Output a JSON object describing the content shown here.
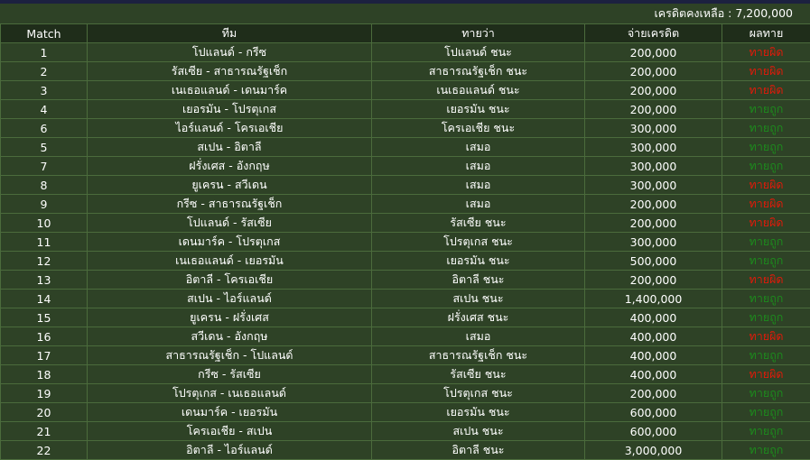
{
  "credit": {
    "text": "เครดิตคงเหลือ : 7,200,000"
  },
  "columns": [
    "Match",
    "ทีม",
    "ทายว่า",
    "จ่ายเครดิต",
    "ผลทาย"
  ],
  "colors": {
    "lose": "#e01a0a",
    "win": "#1d8a1d"
  },
  "rows": [
    {
      "match": "1",
      "team": "โปแลนด์ - กรีซ",
      "pick": "โปแลนด์ ชนะ",
      "pay": "200,000",
      "result": "ทายผิด",
      "result_type": "lose"
    },
    {
      "match": "2",
      "team": "รัสเซีย - สาธารณรัฐเช็ก",
      "pick": "สาธารณรัฐเช็ก ชนะ",
      "pay": "200,000",
      "result": "ทายผิด",
      "result_type": "lose"
    },
    {
      "match": "3",
      "team": "เนเธอแลนด์ - เดนมาร์ค",
      "pick": "เนเธอแลนด์ ชนะ",
      "pay": "200,000",
      "result": "ทายผิด",
      "result_type": "lose"
    },
    {
      "match": "4",
      "team": "เยอรมัน - โปรตุเกส",
      "pick": "เยอรมัน ชนะ",
      "pay": "200,000",
      "result": "ทายถูก",
      "result_type": "win"
    },
    {
      "match": "6",
      "team": "ไอร์แลนด์ - โครเอเชีย",
      "pick": "โครเอเชีย ชนะ",
      "pay": "300,000",
      "result": "ทายถูก",
      "result_type": "win"
    },
    {
      "match": "5",
      "team": "สเปน - อิตาลี",
      "pick": "เสมอ",
      "pay": "300,000",
      "result": "ทายถูก",
      "result_type": "win"
    },
    {
      "match": "7",
      "team": "ฝรั่งเศส - อังกฤษ",
      "pick": "เสมอ",
      "pay": "300,000",
      "result": "ทายถูก",
      "result_type": "win"
    },
    {
      "match": "8",
      "team": "ยูเครน - สวีเดน",
      "pick": "เสมอ",
      "pay": "300,000",
      "result": "ทายผิด",
      "result_type": "lose"
    },
    {
      "match": "9",
      "team": "กรีซ - สาธารณรัฐเช็ก",
      "pick": "เสมอ",
      "pay": "200,000",
      "result": "ทายผิด",
      "result_type": "lose"
    },
    {
      "match": "10",
      "team": "โปแลนด์ - รัสเซีย",
      "pick": "รัสเซีย ชนะ",
      "pay": "200,000",
      "result": "ทายผิด",
      "result_type": "lose"
    },
    {
      "match": "11",
      "team": "เดนมาร์ค - โปรตุเกส",
      "pick": "โปรตุเกส ชนะ",
      "pay": "300,000",
      "result": "ทายถูก",
      "result_type": "win"
    },
    {
      "match": "12",
      "team": "เนเธอแลนด์ - เยอรมัน",
      "pick": "เยอรมัน ชนะ",
      "pay": "500,000",
      "result": "ทายถูก",
      "result_type": "win"
    },
    {
      "match": "13",
      "team": "อิตาลี - โครเอเชีย",
      "pick": "อิตาลี ชนะ",
      "pay": "200,000",
      "result": "ทายผิด",
      "result_type": "lose"
    },
    {
      "match": "14",
      "team": "สเปน - ไอร์แลนด์",
      "pick": "สเปน ชนะ",
      "pay": "1,400,000",
      "result": "ทายถูก",
      "result_type": "win"
    },
    {
      "match": "15",
      "team": "ยูเครน - ฝรั่งเศส",
      "pick": "ฝรั่งเศส ชนะ",
      "pay": "400,000",
      "result": "ทายถูก",
      "result_type": "win"
    },
    {
      "match": "16",
      "team": "สวีเดน - อังกฤษ",
      "pick": "เสมอ",
      "pay": "400,000",
      "result": "ทายผิด",
      "result_type": "lose"
    },
    {
      "match": "17",
      "team": "สาธารณรัฐเช็ก - โปแลนด์",
      "pick": "สาธารณรัฐเช็ก ชนะ",
      "pay": "400,000",
      "result": "ทายถูก",
      "result_type": "win"
    },
    {
      "match": "18",
      "team": "กรีซ - รัสเซีย",
      "pick": "รัสเซีย ชนะ",
      "pay": "400,000",
      "result": "ทายผิด",
      "result_type": "lose"
    },
    {
      "match": "19",
      "team": "โปรตุเกส - เนเธอแลนด์",
      "pick": "โปรตุเกส ชนะ",
      "pay": "200,000",
      "result": "ทายถูก",
      "result_type": "win"
    },
    {
      "match": "20",
      "team": "เดนมาร์ค - เยอรมัน",
      "pick": "เยอรมัน ชนะ",
      "pay": "600,000",
      "result": "ทายถูก",
      "result_type": "win"
    },
    {
      "match": "21",
      "team": "โครเอเชีย - สเปน",
      "pick": "สเปน ชนะ",
      "pay": "600,000",
      "result": "ทายถูก",
      "result_type": "win"
    },
    {
      "match": "22",
      "team": "อิตาลี - ไอร์แลนด์",
      "pick": "อิตาลี ชนะ",
      "pay": "3,000,000",
      "result": "ทายถูก",
      "result_type": "win"
    }
  ]
}
